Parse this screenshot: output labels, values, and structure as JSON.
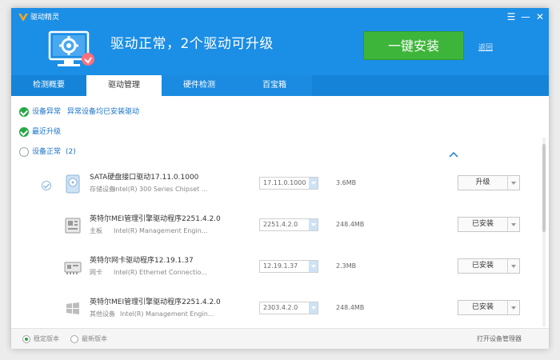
{
  "app": {
    "title": "驱动精灵"
  },
  "window_controls": {
    "menu": "☰",
    "minimize": "—",
    "close": "✕"
  },
  "header": {
    "status": "驱动正常，2个驱动可升级",
    "install_button": "一键安装",
    "back_link": "返回"
  },
  "tabs": [
    {
      "label": "检测概要"
    },
    {
      "label": "驱动管理"
    },
    {
      "label": "硬件检测"
    },
    {
      "label": "百宝箱"
    }
  ],
  "sections": {
    "abnormal": {
      "label": "设备异常",
      "detail": "异常设备均已安装驱动"
    },
    "recent": {
      "label": "最近升级"
    },
    "normal": {
      "label": "设备正常",
      "count": "(2)"
    }
  },
  "drivers": [
    {
      "name": "SATA硬盘接口驱动17.11.0.1000",
      "category": "存储设备",
      "description": "Intel(R) 300 Series Chipset ...",
      "version": "17.11.0.1000",
      "size": "3.6MB",
      "action": "升级"
    },
    {
      "name": "英特尔MEI管理引擎驱动程序2251.4.2.0",
      "category": "主板",
      "description": "Intel(R) Management Engin...",
      "version": "2251.4.2.0",
      "size": "248.4MB",
      "action": "已安装"
    },
    {
      "name": "英特尔网卡驱动程序12.19.1.37",
      "category": "网卡",
      "description": "Intel(R) Ethernet Connectio...",
      "version": "12.19.1.37",
      "size": "2.3MB",
      "action": "已安装"
    },
    {
      "name": "英特尔MEI管理引擎驱动程序2251.4.2.0",
      "category": "其他设备",
      "description": "Intel(R) Management Engin...",
      "version": "2303.4.2.0",
      "size": "248.4MB",
      "action": "已安装"
    }
  ],
  "footer": {
    "stable_label": "稳定版本",
    "latest_label": "最新版本",
    "device_manager_link": "打开设备管理器"
  },
  "colors": {
    "header_blue": "#1b8ee6",
    "install_green": "#3db53a",
    "check_green": "#27a845"
  }
}
